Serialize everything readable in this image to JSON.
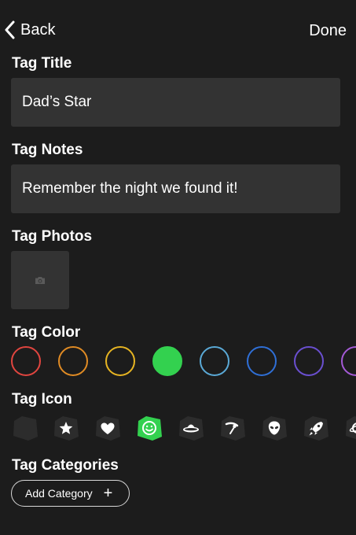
{
  "nav": {
    "back_label": "Back",
    "done_label": "Done"
  },
  "title_section": {
    "label": "Tag Title",
    "value": "Dad’s Star"
  },
  "notes_section": {
    "label": "Tag Notes",
    "value": "Remember the night we found it!"
  },
  "photos_section": {
    "label": "Tag Photos",
    "add_icon": "camera-icon"
  },
  "color_section": {
    "label": "Tag Color",
    "swatches": [
      {
        "color": "#e0453f",
        "selected": false
      },
      {
        "color": "#e08b24",
        "selected": false
      },
      {
        "color": "#e6b422",
        "selected": false
      },
      {
        "color": "#33d14f",
        "selected": true
      },
      {
        "color": "#5aa9d6",
        "selected": false
      },
      {
        "color": "#2f6fd6",
        "selected": false
      },
      {
        "color": "#6a4fd0",
        "selected": false
      },
      {
        "color": "#a45ad6",
        "selected": false
      }
    ]
  },
  "icon_section": {
    "label": "Tag Icon",
    "icons": [
      "blank-icon",
      "star-icon",
      "heart-icon",
      "smiley-icon",
      "ufo-icon",
      "satellite-icon",
      "alien-icon",
      "rocket-icon",
      "planet-icon"
    ],
    "selected": "smiley-icon",
    "selected_color": "#33d14f"
  },
  "categories_section": {
    "label": "Tag Categories",
    "add_label": "Add Category",
    "add_icon": "plus-icon"
  }
}
